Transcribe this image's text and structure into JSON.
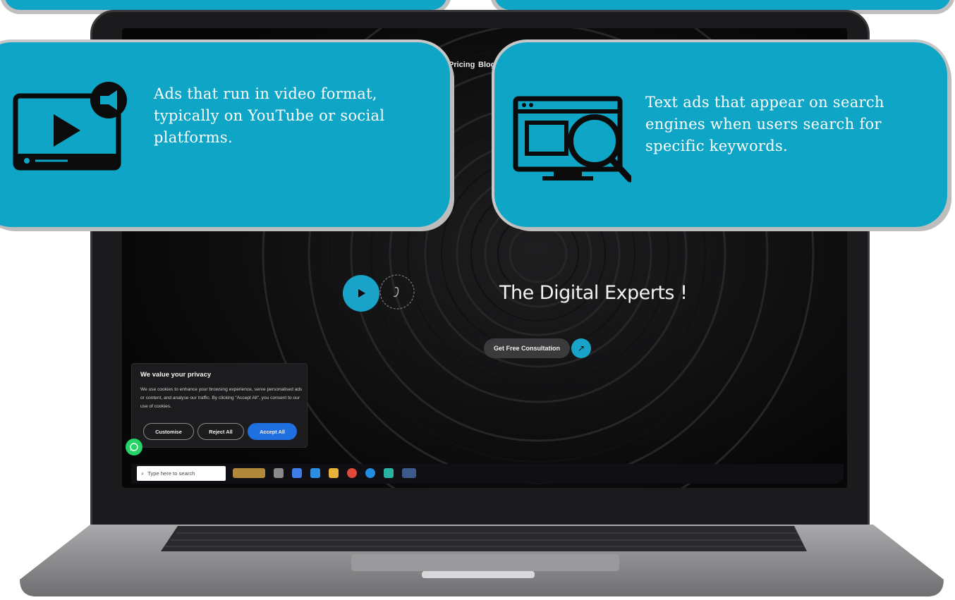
{
  "video_card": {
    "text": "Ads that run in video format, typically on YouTube or social platforms.",
    "icon": "video-ad-icon",
    "background": "#0ea5c7"
  },
  "search_card": {
    "text": "Text ads that appear on search engines when users search for specific keywords.",
    "icon": "search-ad-icon",
    "background": "#0ea5c7"
  },
  "screen": {
    "nav": {
      "pricing": "Pricing",
      "blogs": "Blogs"
    },
    "hero_title": "The Digital Experts !",
    "cta_label": "Get Free Consultation",
    "accent": "#1aa3c8"
  },
  "privacy": {
    "title": "We value your privacy",
    "body": "We use cookies to enhance your browsing experience, serve personalised ads or content, and analyse our traffic. By clicking \"Accept All\", you consent to our use of cookies.",
    "customise": "Customise",
    "reject": "Reject All",
    "accept": "Accept All"
  },
  "taskbar": {
    "search_placeholder": "Type here to search",
    "apps": [
      "task-view",
      "copilot",
      "store",
      "file-explorer",
      "chrome",
      "edge",
      "app-green",
      "chrome-active"
    ]
  }
}
